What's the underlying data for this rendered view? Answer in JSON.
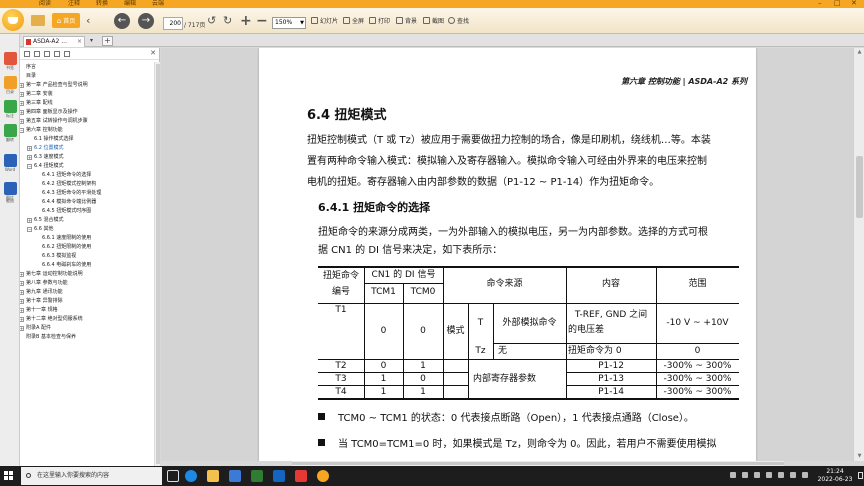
{
  "menu": [
    "阅读",
    "注释",
    "转换",
    "编辑",
    "云端"
  ],
  "window_controls": [
    "–",
    "□",
    "✕"
  ],
  "toolbar": {
    "home": "首页",
    "page_current": "200",
    "page_total": "/ 717页",
    "zoom": "150%",
    "slideshow": "幻灯片",
    "fullscreen": "全屏",
    "print": "打印",
    "background": "背景",
    "screenshot": "截图",
    "find": "查找"
  },
  "dock": [
    "书签",
    "目录",
    "标注",
    "翻转",
    "Word",
    "图片",
    "截图"
  ],
  "tab": {
    "title": "ASDA-A2 ...",
    "close": "×"
  },
  "toc": [
    {
      "label": "序言",
      "level": 0,
      "toggle": ""
    },
    {
      "label": "目录",
      "level": 0,
      "toggle": ""
    },
    {
      "label": "第一章 产品检查与型号说明",
      "level": 0,
      "toggle": "+"
    },
    {
      "label": "第二章 安装",
      "level": 0,
      "toggle": "+"
    },
    {
      "label": "第三章 配线",
      "level": 0,
      "toggle": "+"
    },
    {
      "label": "第四章 面板显示及操作",
      "level": 0,
      "toggle": "+"
    },
    {
      "label": "第五章 试转操作与调机步骤",
      "level": 0,
      "toggle": "+"
    },
    {
      "label": "第六章 控制功能",
      "level": 0,
      "toggle": "−"
    },
    {
      "label": "6.1 操作模式选择",
      "level": 1,
      "toggle": ""
    },
    {
      "label": "6.2 位置模式",
      "level": 1,
      "toggle": "+",
      "active": true
    },
    {
      "label": "6.3 速度模式",
      "level": 1,
      "toggle": "+"
    },
    {
      "label": "6.4 扭矩模式",
      "level": 1,
      "toggle": "−"
    },
    {
      "label": "6.4.1 扭矩命令的选择",
      "level": 2,
      "toggle": ""
    },
    {
      "label": "6.4.2 扭矩模式控制架构",
      "level": 2,
      "toggle": ""
    },
    {
      "label": "6.4.3 扭矩命令的平滑处理",
      "level": 2,
      "toggle": ""
    },
    {
      "label": "6.4.4 模拟命令端比例器",
      "level": 2,
      "toggle": ""
    },
    {
      "label": "6.4.5 扭矩模式时序图",
      "level": 2,
      "toggle": ""
    },
    {
      "label": "6.5 混合模式",
      "level": 1,
      "toggle": "+"
    },
    {
      "label": "6.6 其他",
      "level": 1,
      "toggle": "−"
    },
    {
      "label": "6.6.1 速度限制的使用",
      "level": 2,
      "toggle": ""
    },
    {
      "label": "6.6.2 扭矩限制的使用",
      "level": 2,
      "toggle": ""
    },
    {
      "label": "6.6.3 模拟监视",
      "level": 2,
      "toggle": ""
    },
    {
      "label": "6.6.4 电磁刹车的使用",
      "level": 2,
      "toggle": ""
    },
    {
      "label": "第七章 运动控制功能说明",
      "level": 0,
      "toggle": "+"
    },
    {
      "label": "第八章 参数与功能",
      "level": 0,
      "toggle": "+"
    },
    {
      "label": "第九章 通讯功能",
      "level": 0,
      "toggle": "+"
    },
    {
      "label": "第十章 异警排除",
      "level": 0,
      "toggle": "+"
    },
    {
      "label": "第十一章 规格",
      "level": 0,
      "toggle": "+"
    },
    {
      "label": "第十二章 绝对型伺服系统",
      "level": 0,
      "toggle": "+"
    },
    {
      "label": "附录A 配件",
      "level": 0,
      "toggle": "+"
    },
    {
      "label": "附录B 基本检查与保养",
      "level": 0,
      "toggle": ""
    }
  ],
  "document": {
    "chapter_header": "第六章 控制功能 | ASDA-A2 系列",
    "section_title": "6.4   扭矩模式",
    "para1": [
      "扭矩控制模式（T 或 Tz）被应用于需要做扭力控制的场合，像是印刷机，绕线机…等。本装",
      "置有两种命令输入模式：模拟输入及寄存器输入。模拟命令输入可经由外界来的电压来控制",
      "电机的扭矩。寄存器输入由内部参数的数据（P1-12 ~ P1-14）作为扭矩命令。"
    ],
    "subsection_title": "6.4.1   扭矩命令的选择",
    "para2": [
      "扭矩命令的来源分成两类，一为外部输入的模拟电压，另一为内部参数。选择的方式可根",
      "据 CN1 的 DI 信号来决定，如下表所示："
    ],
    "table": {
      "h_cmd_no": [
        "扭矩命令",
        "编号"
      ],
      "h_di": "CN1 的 DI 信号",
      "h_tcm1": "TCM1",
      "h_tcm0": "TCM0",
      "h_source": "命令来源",
      "h_content": "内容",
      "h_range": "范围",
      "rows": [
        {
          "id": "T1",
          "tcm1": "0",
          "tcm0": "0",
          "mode": "模式",
          "sub1": "T",
          "src1": "外部模拟命令",
          "content1": [
            "T-REF, GND 之间",
            "的电压差"
          ],
          "range1": "-10 V ~ +10V",
          "sub2": "Tz",
          "src2": "无",
          "content2": "扭矩命令为 0",
          "range2": "0"
        },
        {
          "id": "T2",
          "tcm1": "0",
          "tcm0": "1",
          "content": "P1-12",
          "range": "-300% ~ 300%"
        },
        {
          "id": "T3",
          "tcm1": "1",
          "tcm0": "0",
          "content": "P1-13",
          "range": "-300% ~ 300%"
        },
        {
          "id": "T4",
          "tcm1": "1",
          "tcm0": "1",
          "content": "P1-14",
          "range": "-300% ~ 300%"
        }
      ],
      "internal_source": "内部寄存器参数"
    },
    "bullet1": "TCM0 ~ TCM1 的状态：0 代表接点断路（Open），1 代表接点通路（Close）。",
    "bullet2": "当 TCM0=TCM1=0 时，如果模式是 Tz，则命令为 0。因此，若用户不需要使用模拟"
  },
  "taskbar": {
    "search_placeholder": "在这里输入你要搜索的内容",
    "time": "21:24",
    "date": "2022-06-23"
  },
  "colors": {
    "accent": "#f5a623",
    "link": "#1b5fb4",
    "taskbar": "#1d1d1d"
  }
}
